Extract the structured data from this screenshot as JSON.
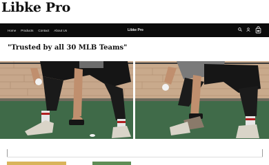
{
  "brand": {
    "title": "Libke Pro"
  },
  "nav": {
    "links": [
      "Home",
      "Products",
      "Contact",
      "About Us"
    ],
    "center_title": "Libke Pro",
    "icons": [
      "search-icon",
      "account-icon",
      "cart-icon"
    ]
  },
  "hero": {
    "headline": "\"Trusted by all 30 MLB Teams\""
  },
  "colors": {
    "nav_bg": "#0b0b0b",
    "turf": "#3f6a48",
    "wall": "#c9a98a"
  }
}
